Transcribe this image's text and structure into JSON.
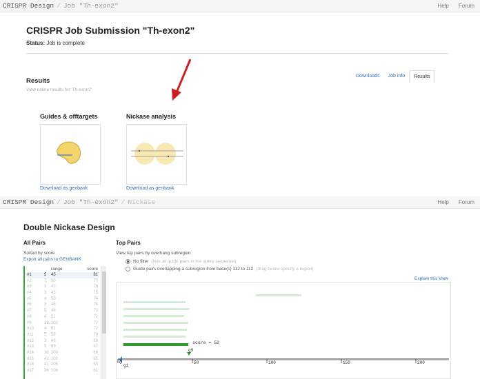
{
  "top_nav": {
    "home": "CRISPR Design",
    "job": "Job \"Th-exon2\"",
    "help": "Help",
    "forum": "Forum"
  },
  "job": {
    "title": "CRISPR Job Submission \"Th-exon2\"",
    "status_label": "Status:",
    "status_value": "Job is complete"
  },
  "results": {
    "heading": "Results",
    "subtitle": "View online results for 'Th-exon2'",
    "tabs": [
      "Downloads",
      "Job info",
      "Results"
    ],
    "active_tab": "Results"
  },
  "panels": [
    {
      "title": "Guides & offtargets",
      "link": "Download as genbank"
    },
    {
      "title": "Nickase analysis",
      "link": "Download as genbank"
    }
  ],
  "bottom_nav": {
    "home": "CRISPR Design",
    "job": "Job \"Th-exon2\"",
    "current": "Nickase",
    "help": "Help",
    "forum": "Forum"
  },
  "nickase": {
    "title": "Double Nickase Design",
    "all_pairs": {
      "heading": "All Pairs",
      "sorted": "Sorted by score",
      "export": "Export all pairs to GENBANK",
      "columns": [
        "",
        "",
        "range",
        "score"
      ],
      "rows": [
        [
          "#1",
          "5",
          "45",
          "81"
        ],
        [
          "#2",
          "7",
          "50",
          "77"
        ],
        [
          "#3",
          "3",
          "43",
          "76"
        ],
        [
          "#4",
          "3",
          "43",
          "75"
        ],
        [
          "#5",
          "4",
          "50",
          "74"
        ],
        [
          "#6",
          "3",
          "46",
          "74"
        ],
        [
          "#7",
          "5",
          "48",
          "73"
        ],
        [
          "#8",
          "4",
          "51",
          "72"
        ],
        [
          "#9",
          "36",
          "102",
          "72"
        ],
        [
          "#10",
          "4",
          "51",
          "72"
        ],
        [
          "#11",
          "5",
          "58",
          "70"
        ],
        [
          "#12",
          "3",
          "46",
          "69"
        ],
        [
          "#13",
          "5",
          "59",
          "67"
        ],
        [
          "#14",
          "36",
          "100",
          "66"
        ],
        [
          "#15",
          "41",
          "102",
          "65"
        ],
        [
          "#16",
          "41",
          "105",
          "63"
        ],
        [
          "#17",
          "36",
          "106",
          "61"
        ]
      ]
    },
    "top_pairs": {
      "heading": "Top Pairs",
      "subtitle": "View top pairs by overhang subregion",
      "option1": "No filter",
      "option1_note": "(lists all guide pairs in the query sequence)",
      "option2": "Guide pairs overlapping a subregion from base(s) 112 to 112",
      "option2_note": "(drag below specify a region)",
      "explain": "Explain this View",
      "score_label": "score = 52",
      "marker_label": "g9",
      "start_label": "g1",
      "axis_ticks": [
        "0",
        "50",
        "100",
        "150",
        "200"
      ]
    }
  },
  "colors": {
    "link": "#2a6fb5",
    "green": "#2e9b2e",
    "light_green": "#cfe8cf",
    "arrow": "#cc1f1f"
  }
}
